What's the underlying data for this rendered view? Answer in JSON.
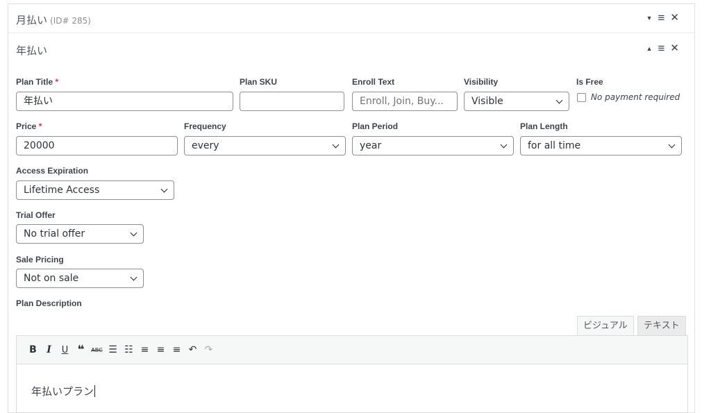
{
  "plans": [
    {
      "name": "月払い",
      "id_label": "(ID# 285)",
      "toggle_icon": "caret-down-icon"
    },
    {
      "name": "年払い",
      "toggle_icon": "caret-up-icon"
    }
  ],
  "form": {
    "plan_title": {
      "label": "Plan Title",
      "required_mark": "*",
      "value": "年払い"
    },
    "plan_sku": {
      "label": "Plan SKU",
      "value": ""
    },
    "enroll_text": {
      "label": "Enroll Text",
      "placeholder": "Enroll, Join, Buy..."
    },
    "visibility": {
      "label": "Visibility",
      "value": "Visible"
    },
    "is_free": {
      "label": "Is Free",
      "checkbox_label": "No payment required",
      "checked": false
    },
    "price": {
      "label": "Price",
      "required_mark": "*",
      "value": "20000"
    },
    "frequency": {
      "label": "Frequency",
      "value": "every"
    },
    "plan_period": {
      "label": "Plan Period",
      "value": "year"
    },
    "plan_length": {
      "label": "Plan Length",
      "value": "for all time"
    },
    "access_expiration": {
      "label": "Access Expiration",
      "value": "Lifetime Access"
    },
    "trial_offer": {
      "label": "Trial Offer",
      "value": "No trial offer"
    },
    "sale_pricing": {
      "label": "Sale Pricing",
      "value": "Not on sale"
    },
    "plan_description": {
      "label": "Plan Description"
    }
  },
  "editor": {
    "tabs": {
      "visual": "ビジュアル",
      "text": "テキスト"
    },
    "toolbar": {
      "bold": "B",
      "italic": "I",
      "underline": "U",
      "blockquote": "❝",
      "strikethrough": "ABC",
      "bullet_list": "☰",
      "numbered_list": "☷",
      "align_left": "≡",
      "align_center": "≡",
      "align_right": "≡",
      "undo": "↶",
      "redo": "↷"
    },
    "content": "年払いプラン"
  },
  "colors": {
    "required": "#d63638",
    "border": "#8c8f94"
  }
}
